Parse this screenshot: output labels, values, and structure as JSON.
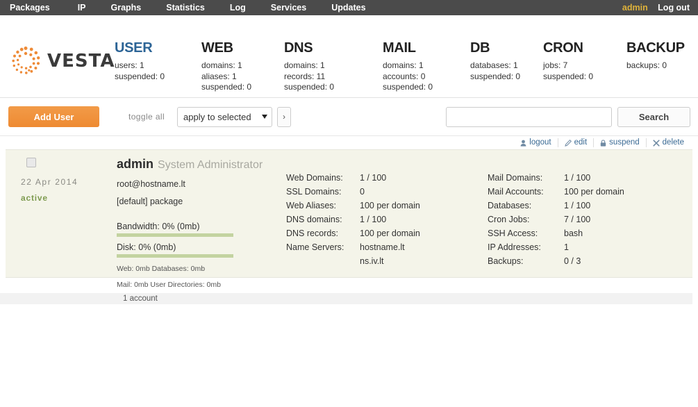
{
  "topbar": {
    "nav": [
      {
        "label": "Packages",
        "name": "nav-packages"
      },
      {
        "label": "IP",
        "name": "nav-ip"
      },
      {
        "label": "Graphs",
        "name": "nav-graphs"
      },
      {
        "label": "Statistics",
        "name": "nav-statistics"
      },
      {
        "label": "Log",
        "name": "nav-log"
      },
      {
        "label": "Services",
        "name": "nav-services"
      },
      {
        "label": "Updates",
        "name": "nav-updates"
      }
    ],
    "user": "admin",
    "logout": "Log out"
  },
  "brand": {
    "name": "VESTA"
  },
  "statsmenu": [
    {
      "title": "USER",
      "active": true,
      "lines": [
        "users: 1",
        "suspended: 0"
      ]
    },
    {
      "title": "WEB",
      "active": false,
      "lines": [
        "domains: 1",
        "aliases: 1",
        "suspended: 0"
      ]
    },
    {
      "title": "DNS",
      "active": false,
      "lines": [
        "domains: 1",
        "records: 11",
        "suspended: 0"
      ]
    },
    {
      "title": "MAIL",
      "active": false,
      "lines": [
        "domains: 1",
        "accounts: 0",
        "suspended: 0"
      ]
    },
    {
      "title": "DB",
      "active": false,
      "lines": [
        "databases: 1",
        "suspended: 0"
      ]
    },
    {
      "title": "CRON",
      "active": false,
      "lines": [
        "jobs: 7",
        "suspended: 0"
      ]
    },
    {
      "title": "BACKUP",
      "active": false,
      "lines": [
        "backups: 0"
      ]
    }
  ],
  "toolbar": {
    "add_label": "Add User",
    "toggle_all": "toggle all",
    "bulk_selected": "apply to selected",
    "bulk_go": "›",
    "search_value": "",
    "search_placeholder": "",
    "search_label": "Search"
  },
  "actions": [
    {
      "label": "logout",
      "icon": "user-icon"
    },
    {
      "label": "edit",
      "icon": "pencil-icon"
    },
    {
      "label": "suspend",
      "icon": "lock-icon"
    },
    {
      "label": "delete",
      "icon": "close-icon"
    }
  ],
  "user": {
    "checkbox_checked": false,
    "date": "22 Apr 2014",
    "status": "active",
    "name": "admin",
    "fullname": "System Administrator",
    "email": "root@hostname.lt",
    "package": "[default] package",
    "bandwidth_label": "Bandwidth: 0% (0mb)",
    "bandwidth_percent": 0,
    "disk_label": "Disk: 0% (0mb)",
    "disk_percent": 0,
    "usage_line1": "Web: 0mb Databases: 0mb",
    "usage_line2": "Mail: 0mb   User Directories: 0mb",
    "stats_mid": [
      {
        "key": "Web Domains:",
        "value": "1 / 100"
      },
      {
        "key": "SSL Domains:",
        "value": "0"
      },
      {
        "key": "Web Aliases:",
        "value": "100 per domain"
      },
      {
        "key": "DNS domains:",
        "value": "1 / 100"
      },
      {
        "key": "DNS records:",
        "value": "100 per domain"
      },
      {
        "key": "Name Servers:",
        "value": "hostname.lt"
      },
      {
        "key": "",
        "value": "ns.iv.lt",
        "cont": true
      }
    ],
    "stats_right": [
      {
        "key": "Mail Domains:",
        "value": "1 / 100"
      },
      {
        "key": "Mail Accounts:",
        "value": "100 per domain"
      },
      {
        "key": "Databases:",
        "value": "1 / 100"
      },
      {
        "key": "Cron Jobs:",
        "value": "7 / 100"
      },
      {
        "key": "SSH Access:",
        "value": "bash"
      },
      {
        "key": "IP Addresses:",
        "value": "1"
      },
      {
        "key": "Backups:",
        "value": "0 / 3"
      }
    ]
  },
  "footer": {
    "count": "1 account"
  },
  "colors": {
    "topbar_bg": "#4b4b4b",
    "accent_orange": "#f0913d",
    "accent_gold": "#ddb13a",
    "link_blue": "#3a6a94",
    "active_tab": "#2c6496",
    "status_green": "#7e9b50",
    "bar_green": "#c3d3a0",
    "row_bg": "#f4f4e9"
  }
}
